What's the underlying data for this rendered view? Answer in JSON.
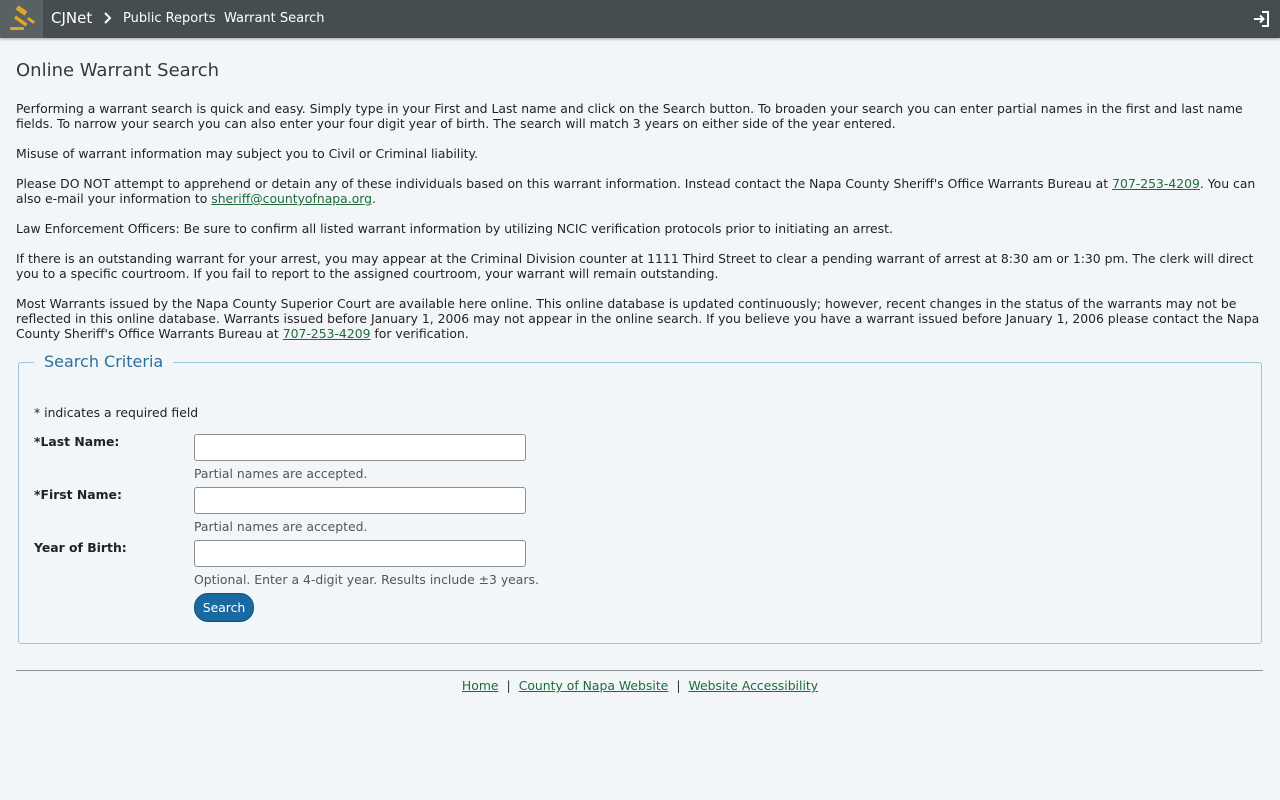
{
  "header": {
    "brand": "CJNet",
    "breadcrumbs": [
      "Public Reports",
      "Warrant Search"
    ],
    "logo_icon": "gavel-icon",
    "login_icon": "sign-in-icon",
    "accent": "#e0a52b"
  },
  "page": {
    "title": "Online Warrant Search",
    "p1": "Performing a warrant search is quick and easy. Simply type in your First and Last name and click on the Search button. To broaden your search you can enter partial names in the first and last name fields. To narrow your search you can also enter your four digit year of birth. The search will match 3 years on either side of the year entered.",
    "p2": "Misuse of warrant information may subject you to Civil or Criminal liability.",
    "p3_a": "Please DO NOT attempt to apprehend or detain any of these individuals based on this warrant information. Instead contact the Napa County Sheriff's Office Warrants Bureau at ",
    "p3_phone": "707-253-4209",
    "p3_b": ". You can also e-mail your information to ",
    "p3_email": "sheriff@countyofnapa.org",
    "p3_c": ".",
    "p4": "Law Enforcement Officers: Be sure to confirm all listed warrant information by utilizing NCIC verification protocols prior to initiating an arrest.",
    "p5": "If there is an outstanding warrant for your arrest, you may appear at the Criminal Division counter at 1111 Third Street to clear a pending warrant of arrest at 8:30 am or 1:30 pm. The clerk will direct you to a specific courtroom. If you fail to report to the assigned courtroom, your warrant will remain outstanding.",
    "p6_a": "Most Warrants issued by the Napa County Superior Court are available here online. This online database is updated continuously; however, recent changes in the status of the warrants may not be reflected in this online database. Warrants issued before January 1, 2006 may not appear in the online search. If you believe you have a warrant issued before January 1, 2006 please contact the Napa County Sheriff's Office Warrants Bureau at ",
    "p6_phone": "707-253-4209",
    "p6_b": " for verification."
  },
  "form": {
    "legend": "Search Criteria",
    "required_note": "* indicates a required field",
    "last_name_label": "*Last Name:",
    "last_name_value": "",
    "last_name_hint": "Partial names are accepted.",
    "first_name_label": "*First Name:",
    "first_name_value": "",
    "first_name_hint": "Partial names are accepted.",
    "yob_label": "Year of Birth:",
    "yob_value": "",
    "yob_hint": "Optional. Enter a 4-digit year. Results include ±3 years.",
    "search_label": "Search"
  },
  "footer": {
    "links": [
      "Home",
      "County of Napa Website",
      "Website Accessibility"
    ],
    "separator": "|"
  }
}
